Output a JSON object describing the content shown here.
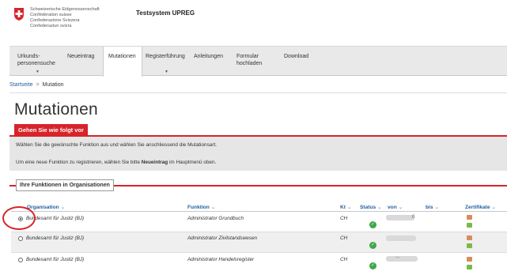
{
  "header": {
    "confederation": [
      "Schweizerische Eidgenossenschaft",
      "Confédération suisse",
      "Confederazione Svizzera",
      "Confederaziun svizra"
    ],
    "app_title": "Testsystem UPREG"
  },
  "nav": {
    "items": [
      {
        "label": "Urkunds-\npersonensuche",
        "has_caret": true
      },
      {
        "label": "Neueintrag",
        "has_caret": false
      },
      {
        "label": "Mutationen",
        "has_caret": false,
        "active": true
      },
      {
        "label": "Registerführung",
        "has_caret": true
      },
      {
        "label": "Anleitungen",
        "has_caret": false
      },
      {
        "label": "Formular\nhochladen",
        "has_caret": false
      },
      {
        "label": "Download",
        "has_caret": false
      }
    ]
  },
  "breadcrumb": {
    "home": "Startseite",
    "separator": ">",
    "current": "Mutation"
  },
  "page_title": "Mutationen",
  "info": {
    "tab_label": "Gehen Sie wie folgt vor",
    "line1": "Wählen Sie die gewünschte Funktion aus und wählen Sie anschliessend die Mutationsart.",
    "line2_prefix": "Um eine neue Funktion zu registrieren, wählen Sie bitte ",
    "line2_bold": "Neueintrag",
    "line2_suffix": " im Hauptmenü oben."
  },
  "panel": {
    "title": "Ihre Funktionen in Organisationen",
    "columns": {
      "organisation": "Organisation",
      "funktion": "Funktion",
      "kt": "Kt",
      "status": "Status",
      "von": "von",
      "bis": "bis",
      "zertifikate": "Zertifikate"
    },
    "rows": [
      {
        "organisation": "Bundesamt für Justiz (BJ)",
        "funktion": "Administrator Grundbuch",
        "kt": "CH",
        "selected": true,
        "von_visible": "0"
      },
      {
        "organisation": "Bundesamt für Justiz (BJ)",
        "funktion": "Administrator Zivilstandswesen",
        "kt": "CH",
        "selected": false,
        "von_visible": ""
      },
      {
        "organisation": "Bundesamt für Justiz (BJ)",
        "funktion": "Administrator Handelsregister",
        "kt": "CH",
        "selected": false,
        "von_visible": "..."
      }
    ]
  },
  "colors": {
    "accent_red": "#d8232a",
    "link_blue": "#1f5f9e",
    "status_green": "#3ea84a"
  }
}
